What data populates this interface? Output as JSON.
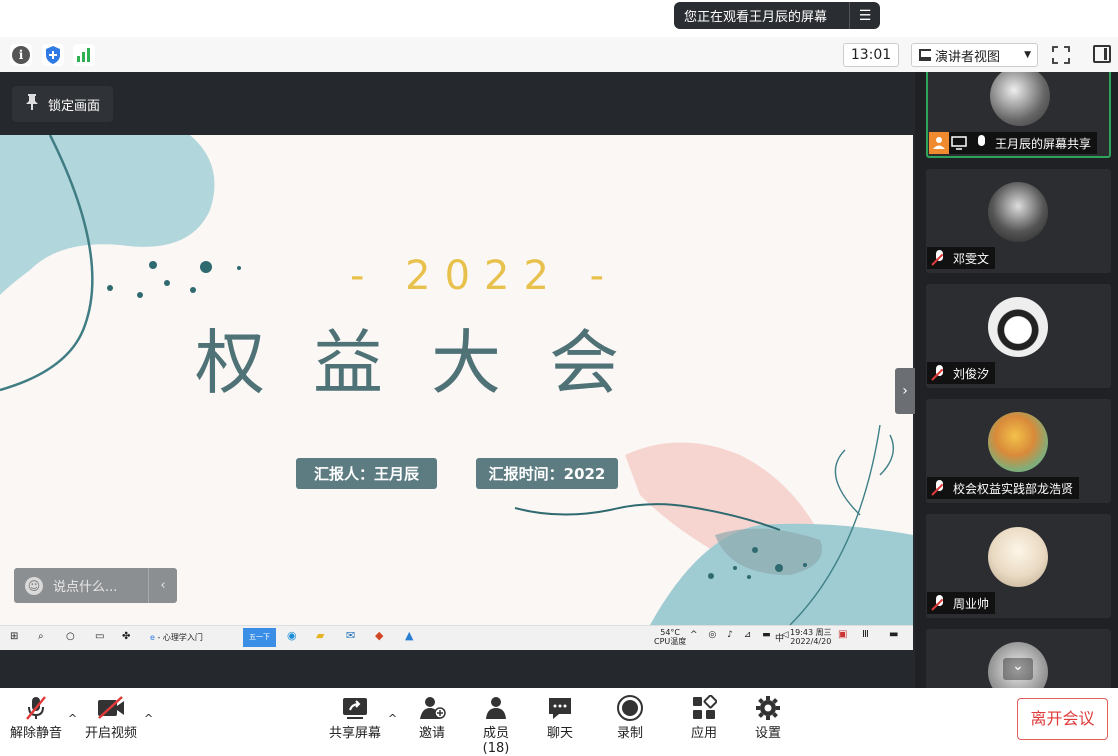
{
  "banner": {
    "text": "您正在观看王月辰的屏幕",
    "menu_icon": "list-icon"
  },
  "toolbar": {
    "clock": "13:01",
    "view_label": "演讲者视图",
    "icons": [
      "info-icon",
      "shield-icon",
      "signal-icon",
      "fullscreen-icon",
      "side-panel-icon"
    ]
  },
  "stage": {
    "lock_label": "锁定画面",
    "slide": {
      "year": "- 2022 -",
      "title": "权益大会",
      "reporter": "汇报人：王月辰",
      "report_time": "汇报时间：2022"
    },
    "chat_placeholder": "说点什么...",
    "taskbar": {
      "search_tab": "心理学入门",
      "active_app": "五一下",
      "weather": "54°C",
      "cpu": "CPU温度",
      "ime": "中",
      "time": "19:43 周三",
      "date": "2022/4/20"
    }
  },
  "participants": [
    {
      "name": "王月辰的屏幕共享",
      "muted": false,
      "active": true,
      "host": true
    },
    {
      "name": "邓雯文",
      "muted": true
    },
    {
      "name": "刘俊汐",
      "muted": true
    },
    {
      "name": "校会权益实践部龙浩贤",
      "muted": true
    },
    {
      "name": "周业帅",
      "muted": true
    }
  ],
  "bottombar": {
    "unmute": "解除静音",
    "video": "开启视频",
    "share": "共享屏幕",
    "invite": "邀请",
    "members": "成员(18)",
    "chat": "聊天",
    "record": "录制",
    "apps": "应用",
    "settings": "设置",
    "leave": "离开会议"
  },
  "colors": {
    "accent_green": "#2fa35c",
    "leave_red": "#e03b3b",
    "slide_teal": "#4f7277",
    "slide_gold": "#e8c14d"
  }
}
